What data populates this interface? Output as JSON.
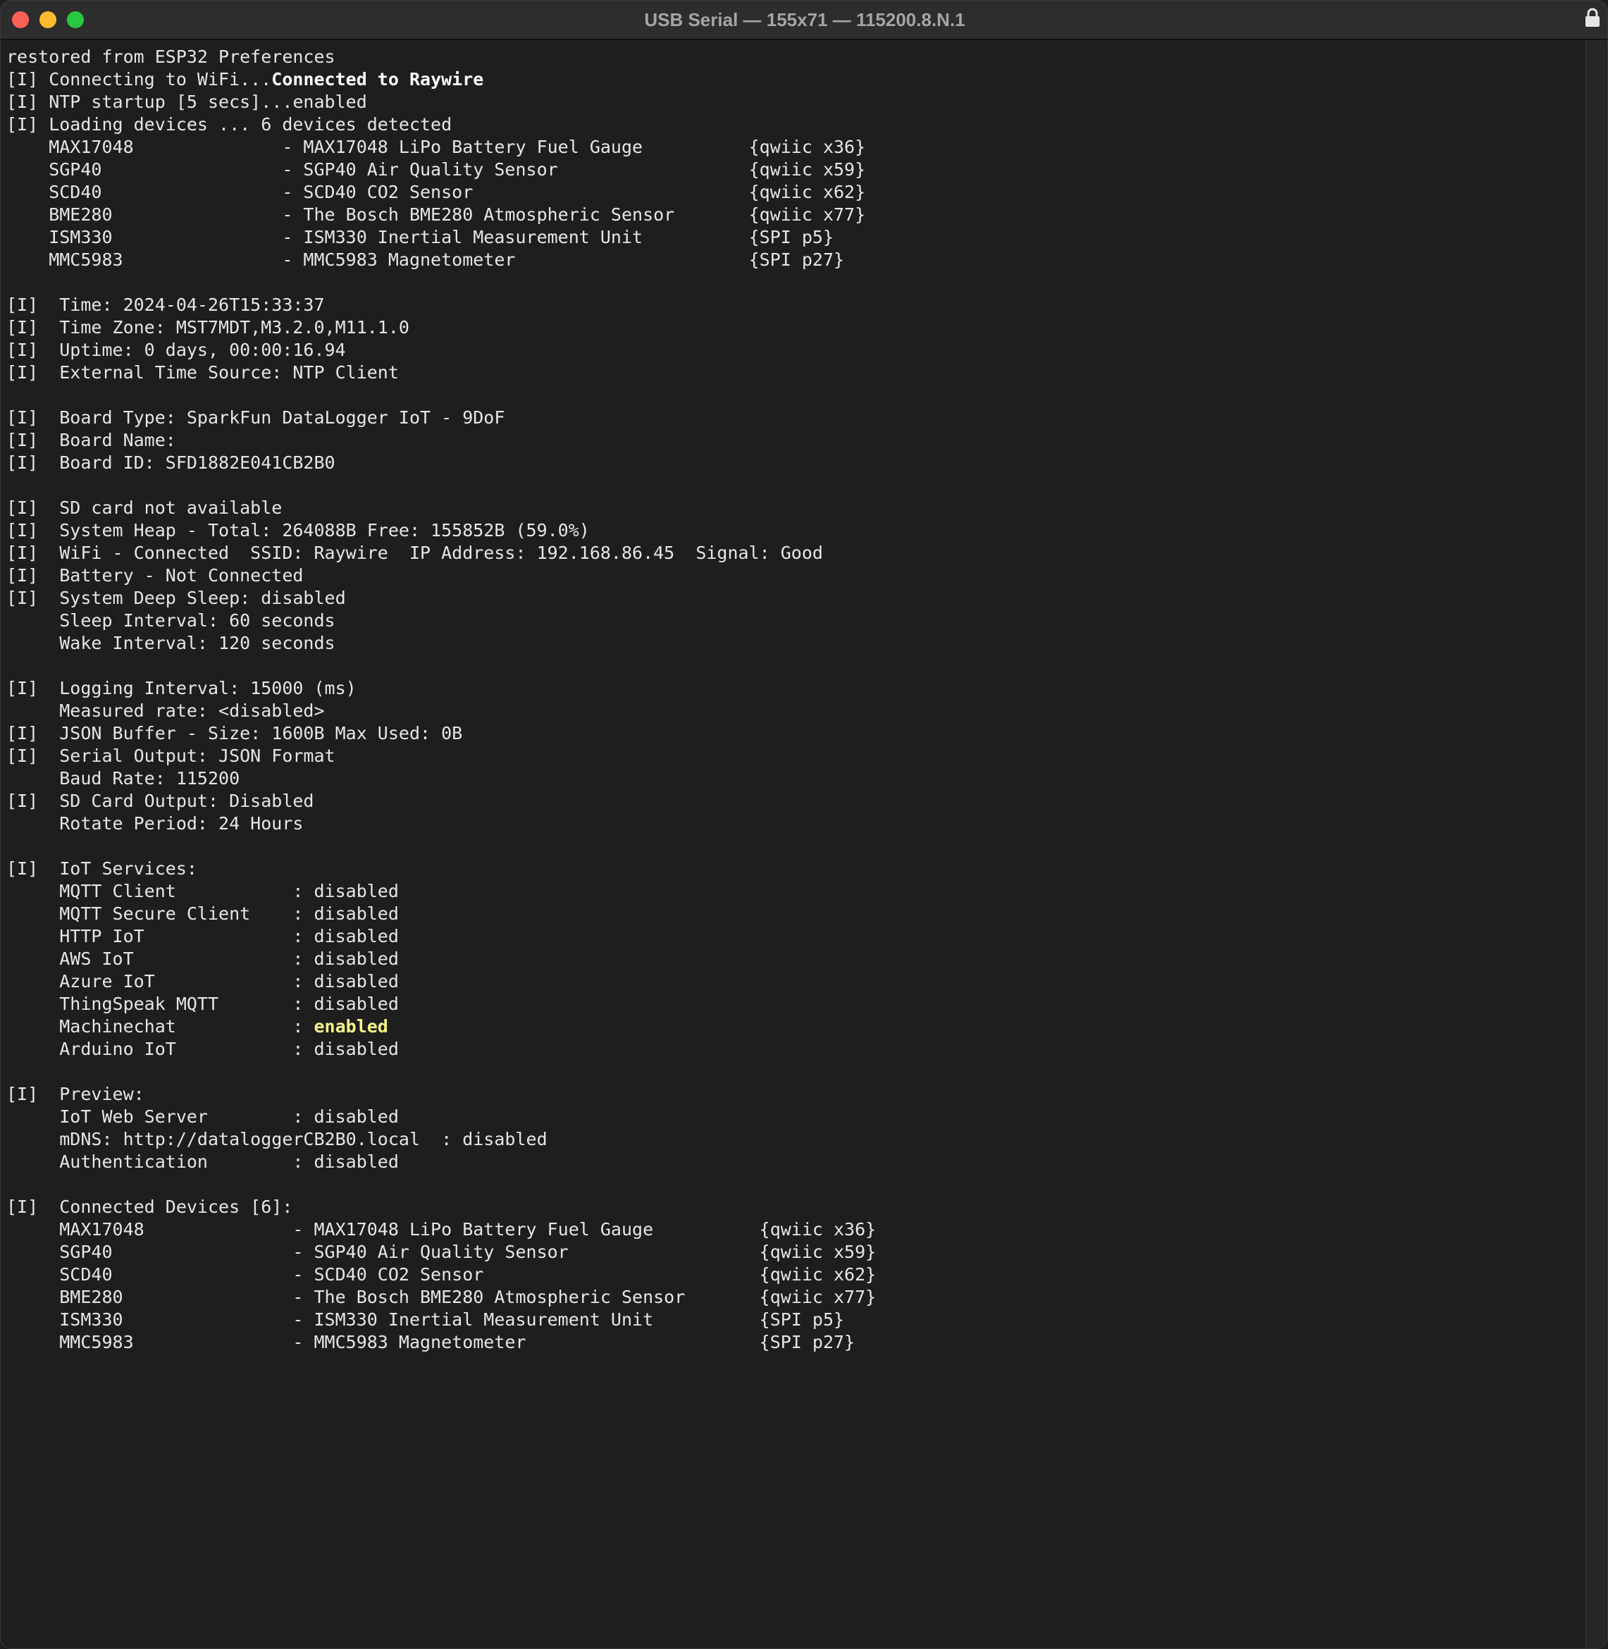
{
  "window": {
    "title": "USB Serial — 155x71 — 115200.8.N.1"
  },
  "colors": {
    "background": "#1e1e1e",
    "text": "#e6e6e6",
    "highlight": "#f4f48a",
    "close": "#fe5f57",
    "minimize": "#febc2e",
    "maximize": "#28c840"
  },
  "icons": {
    "lock": "lock-icon"
  },
  "terminal": {
    "lines": [
      {
        "segments": [
          {
            "text": "restored from ESP32 Preferences"
          }
        ]
      },
      {
        "segments": [
          {
            "text": "[I] Connecting to WiFi..."
          },
          {
            "text": "Connected to Raywire",
            "style": "bold"
          }
        ]
      },
      {
        "segments": [
          {
            "text": "[I] NTP startup [5 secs]...enabled"
          }
        ]
      },
      {
        "segments": [
          {
            "text": "[I] Loading devices ... 6 devices detected"
          }
        ]
      },
      {
        "segments": [
          {
            "text": "    MAX17048              - MAX17048 LiPo Battery Fuel Gauge          {qwiic x36}"
          }
        ]
      },
      {
        "segments": [
          {
            "text": "    SGP40                 - SGP40 Air Quality Sensor                  {qwiic x59}"
          }
        ]
      },
      {
        "segments": [
          {
            "text": "    SCD40                 - SCD40 CO2 Sensor                          {qwiic x62}"
          }
        ]
      },
      {
        "segments": [
          {
            "text": "    BME280                - The Bosch BME280 Atmospheric Sensor       {qwiic x77}"
          }
        ]
      },
      {
        "segments": [
          {
            "text": "    ISM330                - ISM330 Inertial Measurement Unit          {SPI p5}"
          }
        ]
      },
      {
        "segments": [
          {
            "text": "    MMC5983               - MMC5983 Magnetometer                      {SPI p27}"
          }
        ]
      },
      {
        "segments": [
          {
            "text": ""
          }
        ]
      },
      {
        "segments": [
          {
            "text": "[I]  Time: 2024-04-26T15:33:37"
          }
        ]
      },
      {
        "segments": [
          {
            "text": "[I]  Time Zone: MST7MDT,M3.2.0,M11.1.0"
          }
        ]
      },
      {
        "segments": [
          {
            "text": "[I]  Uptime: 0 days, 00:00:16.94"
          }
        ]
      },
      {
        "segments": [
          {
            "text": "[I]  External Time Source: NTP Client"
          }
        ]
      },
      {
        "segments": [
          {
            "text": ""
          }
        ]
      },
      {
        "segments": [
          {
            "text": "[I]  Board Type: SparkFun DataLogger IoT - 9DoF"
          }
        ]
      },
      {
        "segments": [
          {
            "text": "[I]  Board Name:"
          }
        ]
      },
      {
        "segments": [
          {
            "text": "[I]  Board ID: SFD1882E041CB2B0"
          }
        ]
      },
      {
        "segments": [
          {
            "text": ""
          }
        ]
      },
      {
        "segments": [
          {
            "text": "[I]  SD card not available"
          }
        ]
      },
      {
        "segments": [
          {
            "text": "[I]  System Heap - Total: 264088B Free: 155852B (59.0%)"
          }
        ]
      },
      {
        "segments": [
          {
            "text": "[I]  WiFi - Connected  SSID: Raywire  IP Address: 192.168.86.45  Signal: Good"
          }
        ]
      },
      {
        "segments": [
          {
            "text": "[I]  Battery - Not Connected"
          }
        ]
      },
      {
        "segments": [
          {
            "text": "[I]  System Deep Sleep: disabled"
          }
        ]
      },
      {
        "segments": [
          {
            "text": "     Sleep Interval: 60 seconds"
          }
        ]
      },
      {
        "segments": [
          {
            "text": "     Wake Interval: 120 seconds"
          }
        ]
      },
      {
        "segments": [
          {
            "text": ""
          }
        ]
      },
      {
        "segments": [
          {
            "text": "[I]  Logging Interval: 15000 (ms)"
          }
        ]
      },
      {
        "segments": [
          {
            "text": "     Measured rate: <disabled>"
          }
        ]
      },
      {
        "segments": [
          {
            "text": "[I]  JSON Buffer - Size: 1600B Max Used: 0B"
          }
        ]
      },
      {
        "segments": [
          {
            "text": "[I]  Serial Output: JSON Format"
          }
        ]
      },
      {
        "segments": [
          {
            "text": "     Baud Rate: 115200"
          }
        ]
      },
      {
        "segments": [
          {
            "text": "[I]  SD Card Output: Disabled"
          }
        ]
      },
      {
        "segments": [
          {
            "text": "     Rotate Period: 24 Hours"
          }
        ]
      },
      {
        "segments": [
          {
            "text": ""
          }
        ]
      },
      {
        "segments": [
          {
            "text": "[I]  IoT Services:"
          }
        ]
      },
      {
        "segments": [
          {
            "text": "     MQTT Client           : disabled"
          }
        ]
      },
      {
        "segments": [
          {
            "text": "     MQTT Secure Client    : disabled"
          }
        ]
      },
      {
        "segments": [
          {
            "text": "     HTTP IoT              : disabled"
          }
        ]
      },
      {
        "segments": [
          {
            "text": "     AWS IoT               : disabled"
          }
        ]
      },
      {
        "segments": [
          {
            "text": "     Azure IoT             : disabled"
          }
        ]
      },
      {
        "segments": [
          {
            "text": "     ThingSpeak MQTT       : disabled"
          }
        ]
      },
      {
        "segments": [
          {
            "text": "     Machinechat           : "
          },
          {
            "text": "enabled",
            "style": "hl"
          }
        ]
      },
      {
        "segments": [
          {
            "text": "     Arduino IoT           : disabled"
          }
        ]
      },
      {
        "segments": [
          {
            "text": ""
          }
        ]
      },
      {
        "segments": [
          {
            "text": "[I]  Preview:"
          }
        ]
      },
      {
        "segments": [
          {
            "text": "     IoT Web Server        : disabled"
          }
        ]
      },
      {
        "segments": [
          {
            "text": "     mDNS: http://dataloggerCB2B0.local  : disabled"
          }
        ]
      },
      {
        "segments": [
          {
            "text": "     Authentication        : disabled"
          }
        ]
      },
      {
        "segments": [
          {
            "text": ""
          }
        ]
      },
      {
        "segments": [
          {
            "text": "[I]  Connected Devices [6]:"
          }
        ]
      },
      {
        "segments": [
          {
            "text": "     MAX17048              - MAX17048 LiPo Battery Fuel Gauge          {qwiic x36}"
          }
        ]
      },
      {
        "segments": [
          {
            "text": "     SGP40                 - SGP40 Air Quality Sensor                  {qwiic x59}"
          }
        ]
      },
      {
        "segments": [
          {
            "text": "     SCD40                 - SCD40 CO2 Sensor                          {qwiic x62}"
          }
        ]
      },
      {
        "segments": [
          {
            "text": "     BME280                - The Bosch BME280 Atmospheric Sensor       {qwiic x77}"
          }
        ]
      },
      {
        "segments": [
          {
            "text": "     ISM330                - ISM330 Inertial Measurement Unit          {SPI p5}"
          }
        ]
      },
      {
        "segments": [
          {
            "text": "     MMC5983               - MMC5983 Magnetometer                      {SPI p27}"
          }
        ]
      }
    ]
  }
}
